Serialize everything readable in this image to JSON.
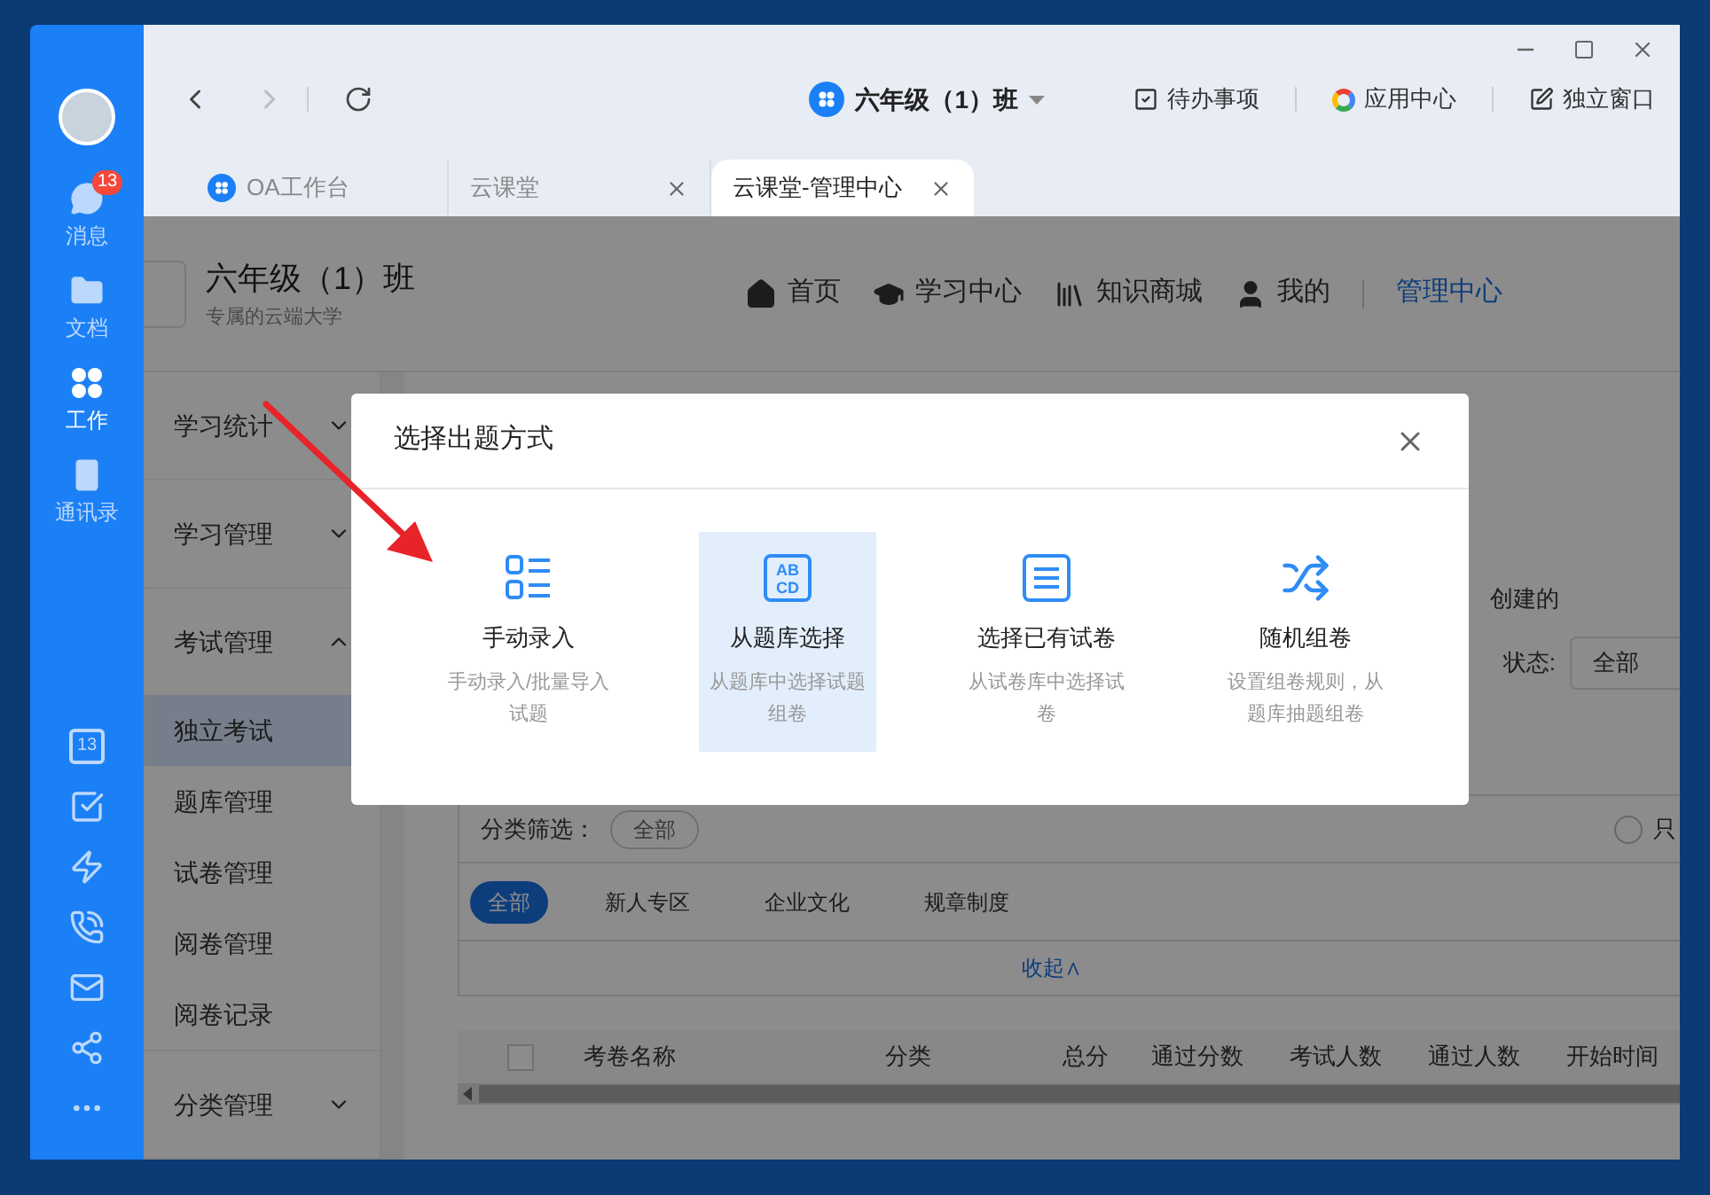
{
  "sidebar": {
    "items": [
      {
        "kind": "message",
        "label": "消息",
        "badge": "13",
        "selected": false
      },
      {
        "kind": "docs",
        "label": "文档",
        "selected": false
      },
      {
        "kind": "work",
        "label": "工作",
        "selected": true
      },
      {
        "kind": "contacts",
        "label": "通讯录",
        "selected": false
      }
    ],
    "tools": [
      {
        "kind": "calendar",
        "text": "13"
      },
      {
        "kind": "todo"
      },
      {
        "kind": "flash"
      },
      {
        "kind": "phone"
      },
      {
        "kind": "mail"
      },
      {
        "kind": "network"
      },
      {
        "kind": "more"
      }
    ]
  },
  "toolbar": {
    "forward_disabled": true,
    "app_title": "六年级（1）班",
    "actions": [
      {
        "kind": "todo",
        "label": "待办事项"
      },
      {
        "kind": "apps",
        "label": "应用中心"
      },
      {
        "kind": "popout",
        "label": "独立窗口"
      }
    ]
  },
  "tabs": [
    {
      "label": "OA工作台",
      "icon": true,
      "closable": false,
      "selected": false
    },
    {
      "label": "云课堂",
      "icon": false,
      "closable": true,
      "selected": false
    },
    {
      "label": "云课堂-管理中心",
      "icon": false,
      "closable": true,
      "selected": true
    }
  ],
  "page": {
    "title": "六年级（1）班",
    "subtitle": "专属的云端大学",
    "nav": [
      {
        "kind": "home",
        "label": "首页",
        "selected": false
      },
      {
        "kind": "learn",
        "label": "学习中心",
        "selected": false
      },
      {
        "kind": "store",
        "label": "知识商城",
        "selected": false
      },
      {
        "kind": "me",
        "label": "我的",
        "selected": false
      },
      {
        "kind": "admin",
        "label": "管理中心",
        "selected": true
      }
    ],
    "menu": [
      {
        "label": "学习统计",
        "expanded": false
      },
      {
        "label": "学习管理",
        "expanded": false
      },
      {
        "label": "考试管理",
        "expanded": true,
        "children": [
          {
            "label": "独立考试",
            "selected": true
          },
          {
            "label": "题库管理",
            "selected": false
          },
          {
            "label": "试卷管理",
            "selected": false
          },
          {
            "label": "阅卷管理",
            "selected": false
          },
          {
            "label": "阅卷记录",
            "selected": false
          }
        ]
      },
      {
        "label": "分类管理",
        "expanded": false
      }
    ],
    "created_text": "创建的",
    "status_label": "状态:",
    "status_value": "全部",
    "filter_label": "分类筛选：",
    "filter_chip": "全部",
    "radio_label": "只",
    "radio_checked": false,
    "chips": [
      {
        "label": "全部",
        "selected": true
      },
      {
        "label": "新人专区",
        "selected": false
      },
      {
        "label": "企业文化",
        "selected": false
      },
      {
        "label": "规章制度",
        "selected": false
      }
    ],
    "collapse": "收起∧",
    "table": {
      "select_all_checked": false,
      "columns": [
        "考卷名称",
        "分类",
        "总分",
        "通过分数",
        "考试人数",
        "通过人数",
        "开始时间"
      ]
    }
  },
  "dialog": {
    "title": "选择出题方式",
    "options": [
      {
        "kind": "list",
        "title": "手动录入",
        "desc": "手动录入/批量导入试题",
        "selected": false
      },
      {
        "kind": "abcd",
        "icon_text": [
          "AB",
          "CD"
        ],
        "title": "从题库选择",
        "desc": "从题库中选择试题组卷",
        "selected": true
      },
      {
        "kind": "paper",
        "title": "选择已有试卷",
        "desc": "从试卷库中选择试卷",
        "selected": false
      },
      {
        "kind": "random",
        "title": "随机组卷",
        "desc": "设置组卷规则，从题库抽题组卷",
        "selected": false
      }
    ]
  }
}
